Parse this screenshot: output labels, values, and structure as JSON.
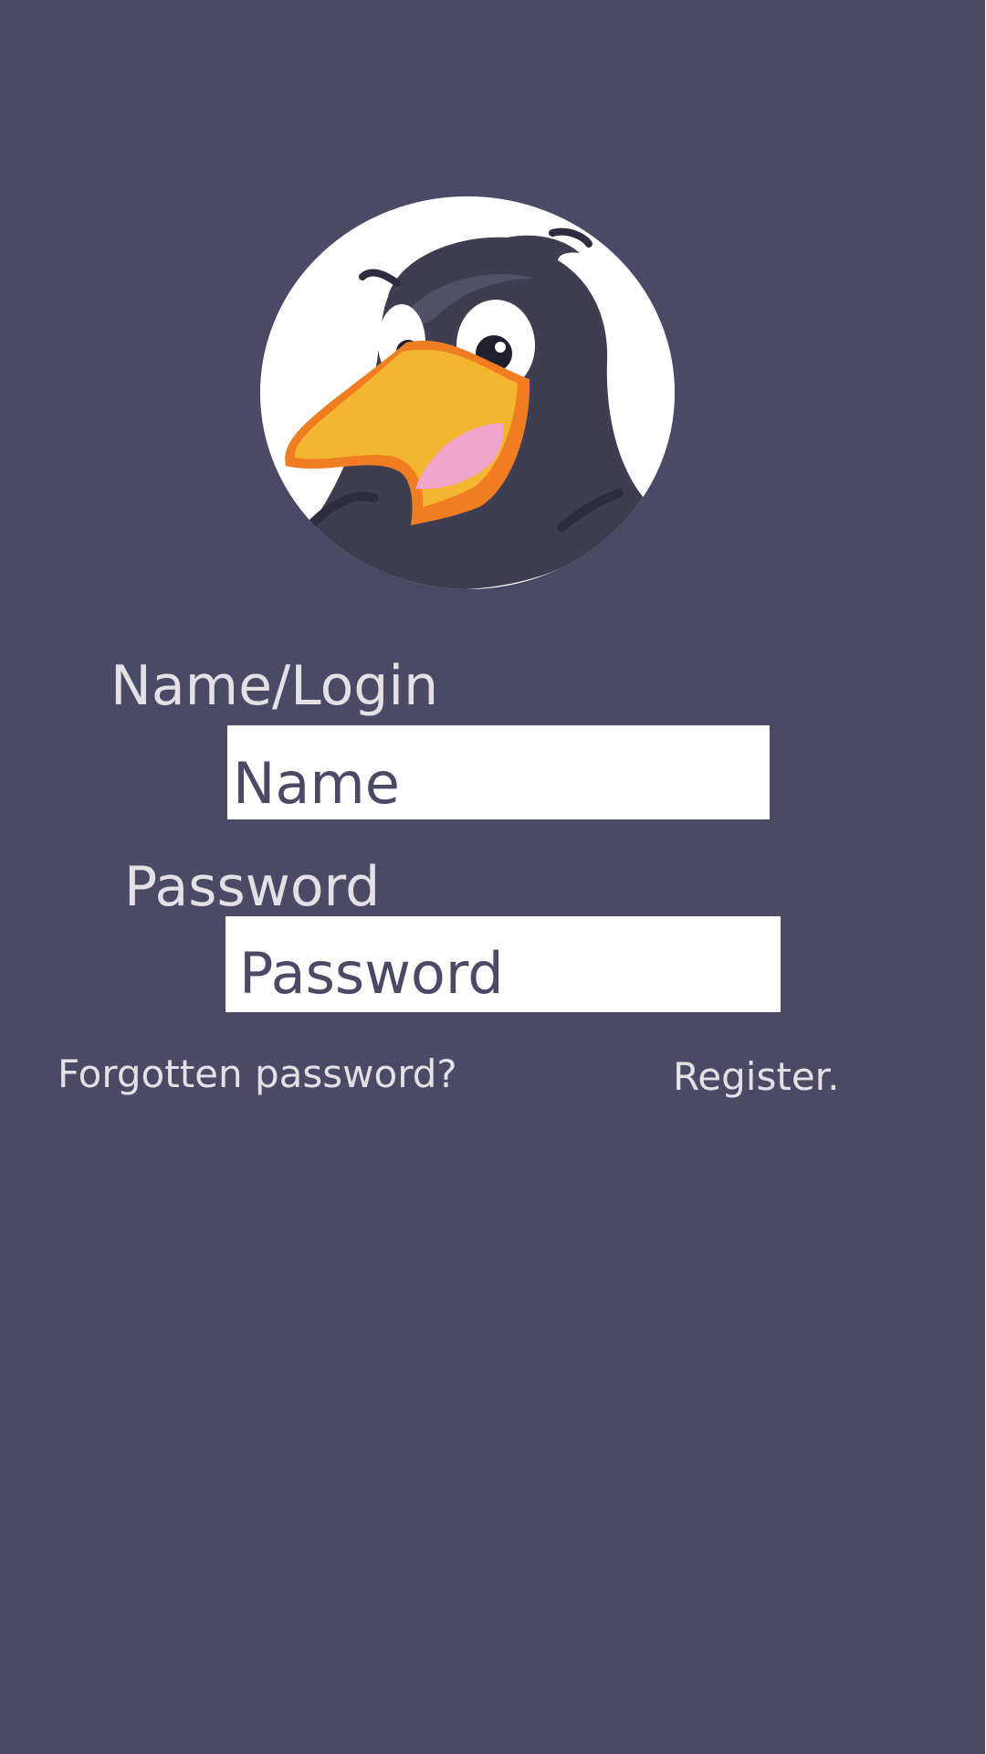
{
  "screen": {
    "background_color": "#4b4a66"
  },
  "logo": {
    "icon": "crow-mascot-icon",
    "colors": {
      "circle": "#ffffff",
      "bird": "#3e3d52",
      "beak": "#f4b630",
      "beak_outline": "#f07d22",
      "tongue": "#efa4ca"
    }
  },
  "login": {
    "name_label": "Name/Login",
    "name_placeholder": "Name",
    "password_label": "Password",
    "password_placeholder": "Password"
  },
  "links": {
    "forgotten_password": "Forgotten password?",
    "register": "Register."
  }
}
